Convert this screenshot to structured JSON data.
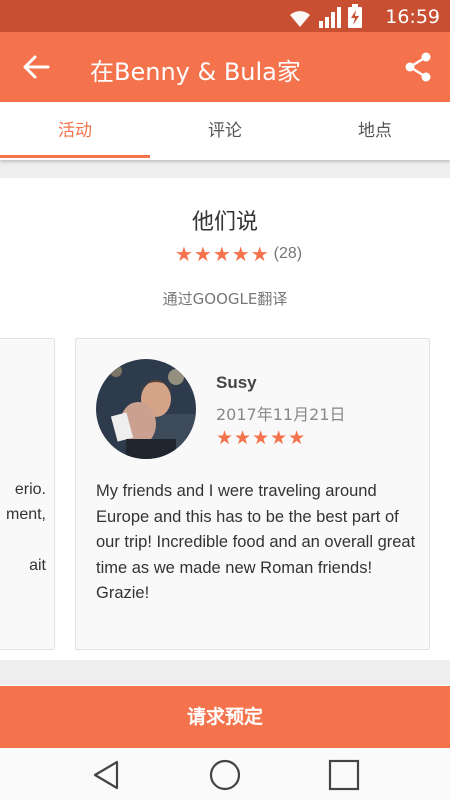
{
  "status_bar": {
    "time": "16:59"
  },
  "app_bar": {
    "title": "在Benny & Bula家"
  },
  "tabs": [
    {
      "label": "活动"
    },
    {
      "label": "评论"
    },
    {
      "label": "地点"
    }
  ],
  "reviews_section": {
    "title": "他们说",
    "stars": "★★★★★",
    "count": "(28)",
    "translated_by": "通过GOOGLE翻译"
  },
  "previous_review": {
    "fragments": [
      "erio.",
      "ment,",
      "ait"
    ]
  },
  "review": {
    "name": "Susy",
    "date": "2017年11月21日",
    "stars": "★★★★★",
    "text": "My friends and I were traveling around Europe and this has to be the best part of our trip! Incredible food and an overall great time as we made new Roman friends! Grazie!"
  },
  "cta": {
    "label": "请求预定"
  },
  "colors": {
    "accent": "#f4734c",
    "status_bar": "#c94f33"
  },
  "icons": {
    "status": [
      "wifi-icon",
      "signal-icon",
      "battery-charging-icon"
    ],
    "app_bar": [
      "back-arrow-icon",
      "share-icon"
    ],
    "nav": [
      "back-nav-icon",
      "home-nav-icon",
      "recents-nav-icon"
    ]
  }
}
